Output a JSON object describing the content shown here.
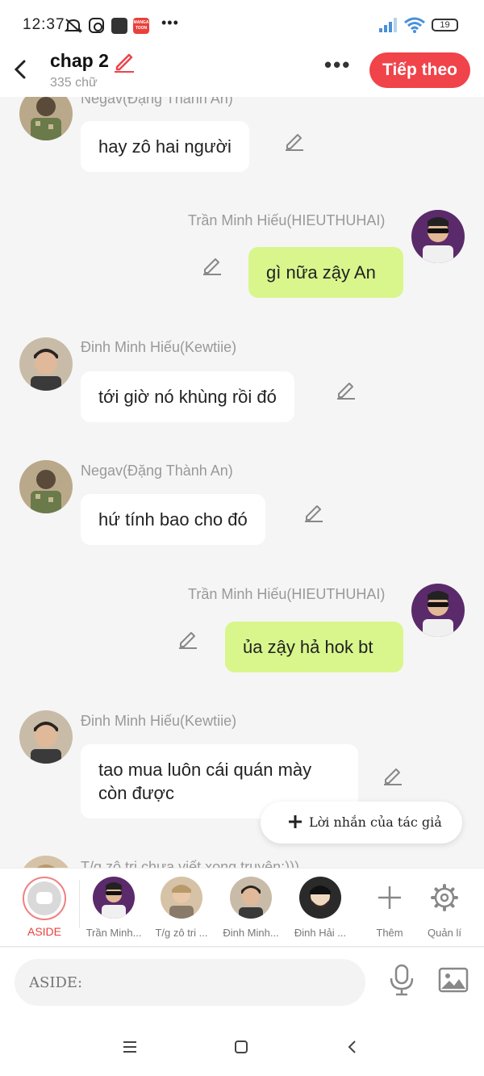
{
  "status_bar": {
    "time": "12:37",
    "battery": "19",
    "icons": [
      "mute-notification-icon",
      "instagram-icon",
      "app-icon",
      "mangatoon-icon",
      "more-dots-icon",
      "signal-icon",
      "wifi-icon",
      "battery-icon"
    ],
    "more_dots": "•••",
    "manga_label": "MANGA TOON"
  },
  "header": {
    "title": "chap 2",
    "word_count": "335 chữ",
    "next_label": "Tiếp theo",
    "more_label": "•••",
    "accent_color": "#f0434a"
  },
  "messages": [
    {
      "name": "Negav(Đặng Thành An)",
      "text": "hay zô hai người",
      "side": "left"
    },
    {
      "name": "Trần Minh Hiếu(HIEUTHUHAI)",
      "text": "gì nữa zậy An",
      "side": "right"
    },
    {
      "name": "Đinh Minh Hiếu(Kewtiie)",
      "text": "tới giờ nó khùng rồi đó",
      "side": "left"
    },
    {
      "name": "Negav(Đặng Thành An)",
      "text": "hứ tính bao cho đó",
      "side": "left"
    },
    {
      "name": "Trần Minh Hiếu(HIEUTHUHAI)",
      "text": "ủa zậy hả hok bt",
      "side": "right"
    },
    {
      "name": "Đinh Minh Hiếu(Kewtiie)",
      "text_line1": "tao mua luôn cái quán mày",
      "text_line2": "còn được",
      "side": "left"
    },
    {
      "name": "T/g zô tri chưa viết xong truyện:)))",
      "side": "left"
    }
  ],
  "author_note_label": "Lời nhắn của tác giả",
  "characters": [
    {
      "label": "ASIDE"
    },
    {
      "label": "Trần Minh..."
    },
    {
      "label": "T/g zô tri ..."
    },
    {
      "label": "Đinh Minh..."
    },
    {
      "label": "Đinh Hải ..."
    },
    {
      "label": "Thêm"
    },
    {
      "label": "Quản lí"
    }
  ],
  "input": {
    "placeholder": "ASIDE:"
  },
  "colors": {
    "bubble_right": "#d9f68c",
    "bubble_left": "#ffffff",
    "background": "#f5f5f5"
  }
}
